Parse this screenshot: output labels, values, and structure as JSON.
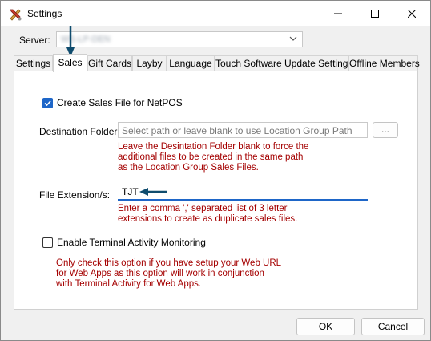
{
  "window": {
    "title": "Settings",
    "icon": "tools-icon"
  },
  "server": {
    "label": "Server:",
    "value": "WS-LP-DEN"
  },
  "tabs": [
    {
      "label": "Settings",
      "active": false
    },
    {
      "label": "Sales",
      "active": true
    },
    {
      "label": "Gift Cards",
      "active": false
    },
    {
      "label": "Layby",
      "active": false
    },
    {
      "label": "Language",
      "active": false
    },
    {
      "label": "Touch Software Update Settings",
      "active": false
    },
    {
      "label": "Offline Members",
      "active": false
    }
  ],
  "sales": {
    "create_file": {
      "label": "Create Sales File for NetPOS",
      "checked": true
    },
    "destination": {
      "label": "Destination Folder:",
      "placeholder": "Select path or leave blank to use Location Group Path",
      "browse_label": "...",
      "help": [
        "Leave the Desintation Folder blank to force the",
        "additional files to be created in the same path",
        "as the Location Group Sales Files."
      ]
    },
    "extension": {
      "label": "File Extension/s:",
      "value": "TJT",
      "help": [
        "Enter a comma ',' separated list of 3 letter",
        "extensions to create as duplicate sales files."
      ]
    },
    "terminal": {
      "label": "Enable Terminal Activity Monitoring",
      "checked": false,
      "help": [
        "Only check this option if you have setup your Web URL",
        "for Web Apps as this option will work in conjunction",
        "with Terminal Activity for Web Apps."
      ]
    }
  },
  "buttons": {
    "ok": "OK",
    "cancel": "Cancel"
  },
  "colors": {
    "accent": "#1e66c8",
    "help_text": "#a40000",
    "annotation_arrow": "#0f4c6e"
  }
}
